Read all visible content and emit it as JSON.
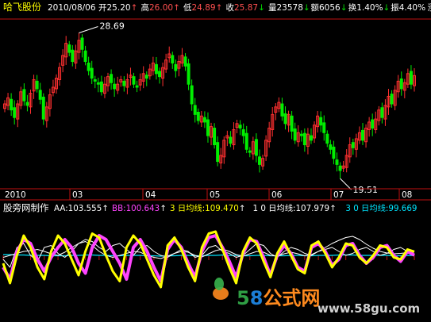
{
  "header": {
    "stock_name": "哈飞股份",
    "date": "2010/08/06",
    "stats": [
      {
        "label": "开",
        "value": "25.20",
        "arrow": "↑",
        "color": "#ffffff"
      },
      {
        "label": "高",
        "value": "26.00",
        "arrow": "↑",
        "color": "#ff5050"
      },
      {
        "label": "低",
        "value": "24.89",
        "arrow": "↑",
        "color": "#ff5050"
      },
      {
        "label": "收",
        "value": "25.87",
        "arrow": "↓",
        "color": "#ff5050"
      },
      {
        "label": "量",
        "value": "23578",
        "arrow": "↓",
        "color": "#ffffff"
      },
      {
        "label": "额",
        "value": "6056",
        "arrow": "↓",
        "color": "#ffffff"
      },
      {
        "label": "换",
        "value": "1.40%",
        "arrow": "↓",
        "color": "#ffffff"
      },
      {
        "label": "振",
        "value": "4.40%",
        "arrow": "",
        "color": "#ffffff"
      },
      {
        "label": "涨",
        "value": "(0.67)2.",
        "arrow": "",
        "color": "#ff5050"
      }
    ]
  },
  "annotations": {
    "high": "28.69",
    "low": "19.51"
  },
  "time_axis": {
    "labels": [
      "2010",
      "03",
      "04",
      "05",
      "06",
      "07",
      "08"
    ]
  },
  "indicator": {
    "name": "股旁网制作",
    "items": [
      {
        "text": "AA:103.555",
        "arrow": "↑",
        "color": "#ffffff"
      },
      {
        "text": "BB:100.643",
        "arrow": "↑",
        "color": "#ff44ff"
      },
      {
        "text": "3 日均线:109.470",
        "arrow": "↑",
        "color": "#ffff00"
      },
      {
        "text": "1 0 日均线:107.979",
        "arrow": "↑",
        "color": "#ffffff"
      },
      {
        "text": "3 0 日均线:99.669",
        "arrow": "",
        "color": "#00e5ff"
      }
    ]
  },
  "watermark": {
    "brand": "58公式网",
    "url": "www.58gu.com"
  },
  "colors": {
    "background": "#000000",
    "up": "#ff3030",
    "down": "#00ee00",
    "frame": "#c01010",
    "aa": "#ffffff",
    "bb": "#ff44ff",
    "ma3": "#ffff00",
    "ma10": "#ffffff",
    "ma30": "#00e5ff"
  },
  "chart_data": {
    "type": "candlestick",
    "price_ylim": [
      18.5,
      29.5
    ],
    "closes": [
      24.0,
      24.4,
      23.6,
      23.1,
      24.0,
      24.8,
      24.2,
      23.9,
      24.7,
      25.6,
      25.0,
      24.3,
      23.0,
      23.8,
      24.6,
      25.1,
      25.7,
      26.4,
      27.2,
      28.0,
      27.4,
      26.8,
      27.5,
      28.2,
      27.6,
      26.8,
      26.2,
      25.7,
      25.5,
      25.3,
      24.8,
      25.3,
      25.8,
      25.4,
      25.0,
      25.3,
      25.6,
      25.2,
      25.6,
      25.9,
      25.3,
      25.1,
      25.6,
      26.0,
      25.7,
      26.3,
      26.7,
      26.0,
      25.8,
      26.4,
      26.9,
      27.3,
      26.7,
      26.2,
      26.8,
      27.2,
      26.5,
      25.3,
      24.0,
      23.3,
      22.9,
      23.2,
      22.8,
      21.9,
      22.5,
      21.3,
      20.2,
      20.6,
      21.6,
      21.9,
      21.4,
      22.3,
      22.7,
      22.4,
      21.9,
      21.0,
      20.8,
      21.5,
      20.6,
      20.0,
      20.4,
      21.6,
      22.4,
      23.3,
      23.8,
      24.1,
      23.2,
      22.7,
      23.3,
      22.2,
      21.6,
      22.1,
      21.9,
      21.3,
      22.0,
      21.6,
      22.6,
      23.2,
      22.6,
      22.1,
      21.4,
      21.0,
      20.4,
      20.0,
      19.6,
      19.9,
      20.6,
      21.3,
      21.1,
      21.7,
      22.1,
      21.6,
      22.4,
      22.8,
      22.4,
      23.0,
      23.6,
      23.1,
      23.9,
      24.5,
      24.0,
      24.9,
      25.5,
      25.0,
      25.4,
      26.0,
      25.3,
      25.87
    ],
    "osc_ylim": [
      0,
      200
    ],
    "series": [
      {
        "name": "AA",
        "values": [
          90,
          70,
          120,
          130,
          100,
          85,
          120,
          125,
          105,
          95,
          110,
          130,
          140,
          135,
          120,
          110,
          125,
          130,
          115,
          100,
          120,
          125,
          110,
          100,
          95,
          105,
          115,
          110,
          95,
          100,
          120,
          125,
          110,
          105,
          95,
          100,
          115,
          130,
          125,
          105,
          95,
          110,
          120,
          115,
          105,
          100,
          110,
          115,
          120,
          110,
          100,
          105,
          115,
          120,
          110,
          100,
          105,
          115,
          120,
          110,
          103.555
        ]
      },
      {
        "name": "BB",
        "values": [
          70,
          40,
          110,
          140,
          130,
          90,
          60,
          95,
          120,
          140,
          120,
          80,
          55,
          120,
          150,
          140,
          110,
          80,
          40,
          120,
          140,
          110,
          70,
          35,
          115,
          140,
          120,
          80,
          45,
          110,
          145,
          150,
          120,
          85,
          45,
          105,
          140,
          135,
          95,
          50,
          100,
          125,
          105,
          70,
          60,
          120,
          130,
          110,
          75,
          90,
          125,
          130,
          100,
          80,
          95,
          120,
          125,
          100,
          85,
          110,
          100.643
        ]
      },
      {
        "name": "3 日均线",
        "values": [
          80,
          30,
          100,
          150,
          120,
          70,
          40,
          110,
          150,
          130,
          90,
          50,
          110,
          155,
          145,
          100,
          60,
          35,
          120,
          150,
          130,
          90,
          50,
          20,
          125,
          145,
          115,
          70,
          35,
          120,
          155,
          160,
          115,
          70,
          30,
          110,
          145,
          130,
          85,
          45,
          105,
          135,
          100,
          65,
          55,
          125,
          135,
          105,
          70,
          95,
          130,
          125,
          95,
          80,
          100,
          125,
          120,
          95,
          90,
          115,
          109.47
        ]
      },
      {
        "name": "1 0 日均线",
        "values": [
          95,
          100,
          105,
          110,
          112,
          115,
          110,
          104,
          100,
          108,
          120,
          130,
          135,
          125,
          110,
          100,
          95,
          100,
          105,
          110,
          108,
          100,
          95,
          92,
          98,
          105,
          110,
          108,
          100,
          96,
          104,
          112,
          116,
          110,
          102,
          98,
          104,
          110,
          108,
          100,
          98,
          104,
          108,
          104,
          99,
          102,
          110,
          120,
          130,
          138,
          145,
          148,
          140,
          128,
          118,
          110,
          106,
          104,
          105,
          107,
          107.979
        ]
      },
      {
        "name": "3 0 日均线",
        "values": [
          102,
          102,
          101,
          101,
          100,
          100,
          100,
          99,
          99,
          99,
          100,
          100,
          101,
          101,
          100,
          100,
          99,
          99,
          100,
          100,
          100,
          99,
          99,
          98,
          99,
          99,
          100,
          100,
          99,
          99,
          100,
          100,
          101,
          100,
          100,
          99,
          99,
          100,
          100,
          99,
          99,
          99,
          100,
          100,
          99,
          99,
          100,
          100,
          100,
          101,
          101,
          101,
          100,
          100,
          100,
          100,
          100,
          99,
          99,
          100,
          99.669
        ]
      }
    ]
  }
}
